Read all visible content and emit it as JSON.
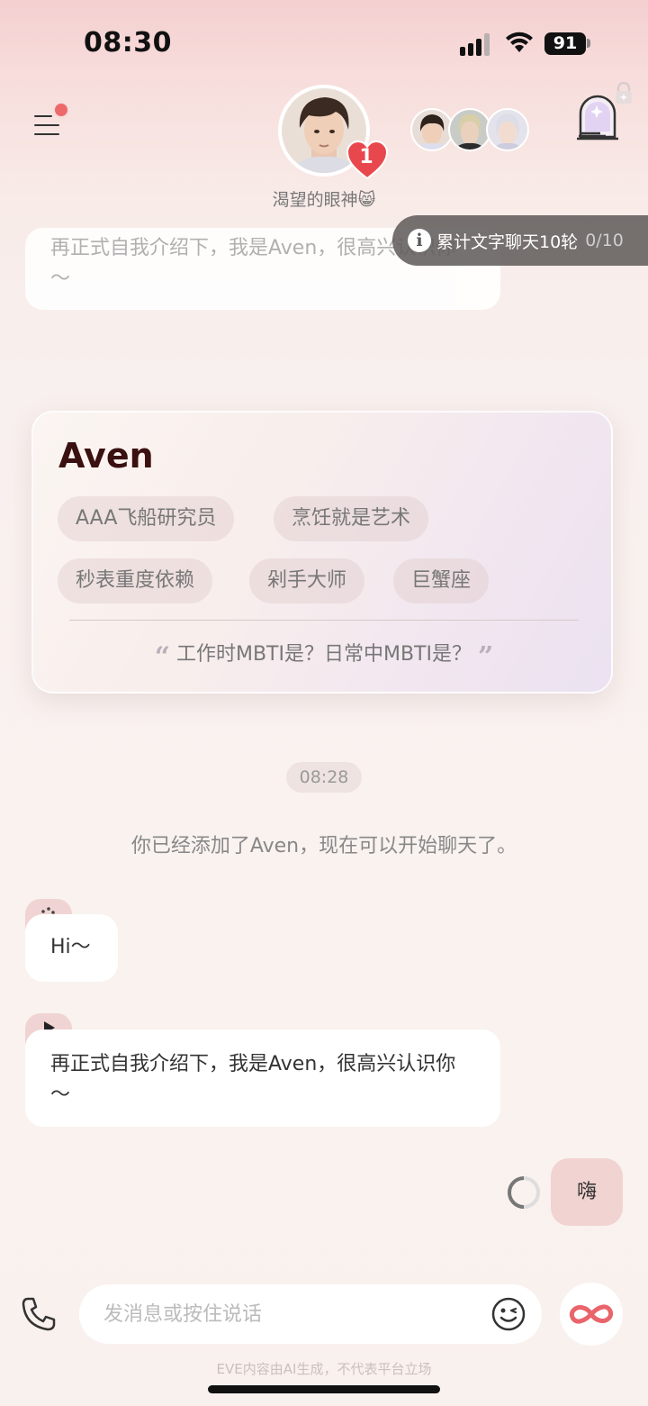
{
  "status_bar": {
    "time": "08:30",
    "battery": "91"
  },
  "header": {
    "character_status": "渴望的眼神😸",
    "heart_count": "1",
    "icons": [
      "menu-icon",
      "heart-icon",
      "door-icon",
      "lock-icon"
    ]
  },
  "toast": {
    "text": "累计文字聊天10轮",
    "count": "0/10"
  },
  "profile_card": {
    "name": "Aven",
    "tags": [
      "AAA飞船研究员",
      "烹饪就是艺术",
      "秒表重度依赖",
      "剁手大师",
      "巨蟹座"
    ],
    "question": "工作时MBTI是？日常中MBTI是？"
  },
  "chat": {
    "faded_message": "再正式自我介绍下，我是Aven，很高兴认识你～",
    "time_chip": "08:28",
    "system_message": "你已经添加了Aven，现在可以开始聊天了。",
    "messages": [
      {
        "from": "character",
        "text": "Hi～"
      },
      {
        "from": "character",
        "text": "再正式自我介绍下，我是Aven，很高兴认识你～"
      },
      {
        "from": "user",
        "text": "嗨"
      }
    ]
  },
  "input": {
    "placeholder": "发消息或按住说话"
  },
  "footer": {
    "disclaimer": "EVE内容由AI生成，不代表平台立场"
  },
  "colors": {
    "accent": "#ec6a6a",
    "user_bubble": "#f1d3d1",
    "name": "#3a1010"
  }
}
